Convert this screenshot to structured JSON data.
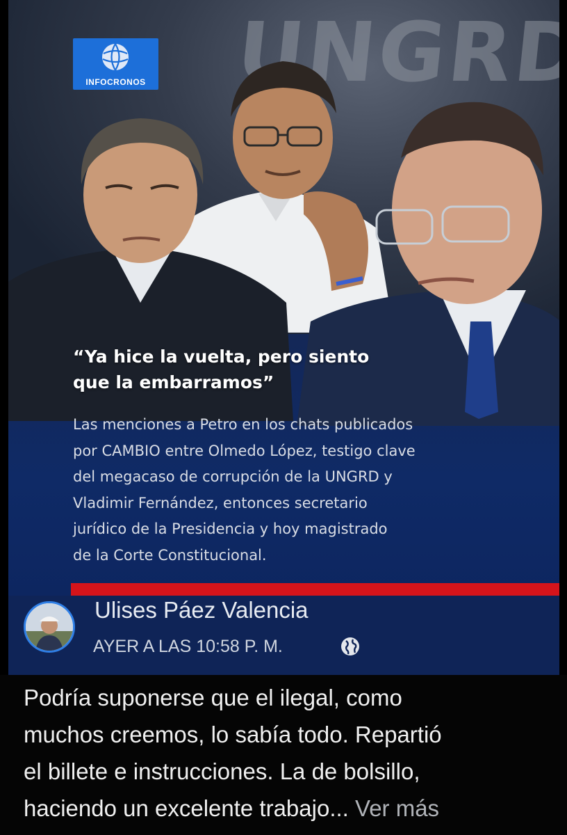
{
  "graphic": {
    "background_sign": "UNGRD",
    "logo_text": "INFOCRONOS",
    "quote": "“Ya hice la vuelta, pero siento\nque la embarramos”",
    "summary": "Las menciones a Petro en los chats publicados\npor CAMBIO entre Olmedo López, testigo clave\ndel megacaso de corrupción de la UNGRD y\nVladimir Fernández, entonces secretario\njurídico de la Presidencia y hoy magistrado\nde la Corte Constitucional.",
    "colors": {
      "accent_red": "#d5141b",
      "logo_blue": "#1d6fd9",
      "header_navy": "#0f2457"
    }
  },
  "post": {
    "author": "Ulises Páez Valencia",
    "timestamp": "AYER A LAS 10:58 P. M.",
    "privacy_icon": "globe-icon",
    "text": "Podría suponerse que el ilegal, como\nmuchos creemos, lo sabía todo. Repartió\nel billete e instrucciones. La de bolsillo,\nhaciendo un excelente trabajo...",
    "see_more": "Ver más"
  }
}
